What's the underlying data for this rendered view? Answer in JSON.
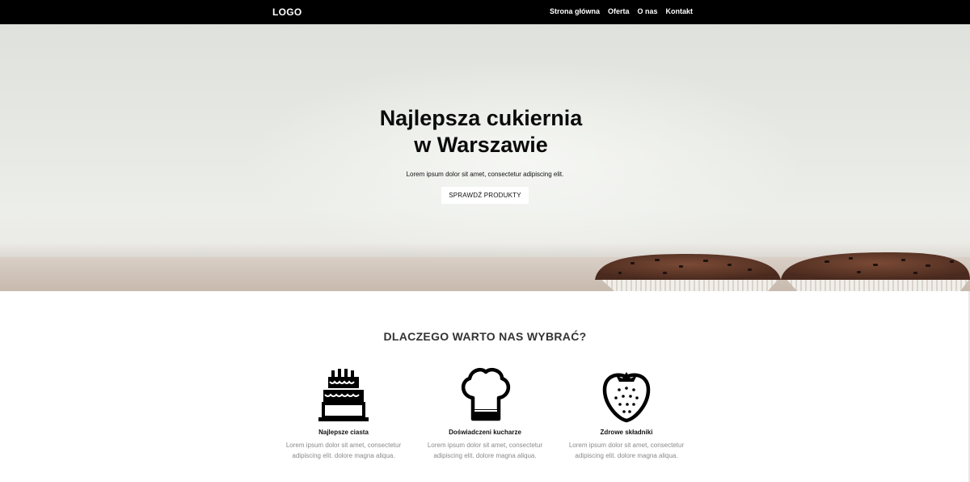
{
  "navbar": {
    "logo": "LOGO",
    "links": [
      {
        "label": "Strona główna"
      },
      {
        "label": "Oferta"
      },
      {
        "label": "O nas"
      },
      {
        "label": "Kontakt"
      }
    ]
  },
  "hero": {
    "title_line1": "Najlepsza cukiernia",
    "title_line2": "w Warszawie",
    "subtitle": "Lorem ipsum dolor sit amet, consectetur adipiscing elit.",
    "button_label": "SPRAWDŹ PRODUKTY"
  },
  "why": {
    "title": "DLACZEGO WARTO NAS WYBRAĆ?",
    "features": [
      {
        "icon": "cake-icon",
        "title": "Najlepsze ciasta",
        "text": "Lorem ipsum dolor sit amet, consectetur adipiscing elit. dolore magna aliqua."
      },
      {
        "icon": "chef-hat-icon",
        "title": "Doświadczeni kucharze",
        "text": "Lorem ipsum dolor sit amet, consectetur adipiscing elit. dolore magna aliqua."
      },
      {
        "icon": "strawberry-icon",
        "title": "Zdrowe składniki",
        "text": "Lorem ipsum dolor sit amet, consectetur adipiscing elit. dolore magna aliqua."
      }
    ]
  },
  "colors": {
    "navbar_bg": "#000000",
    "hero_bg": "#e7e9e4",
    "text_muted": "#8a8a8a"
  }
}
